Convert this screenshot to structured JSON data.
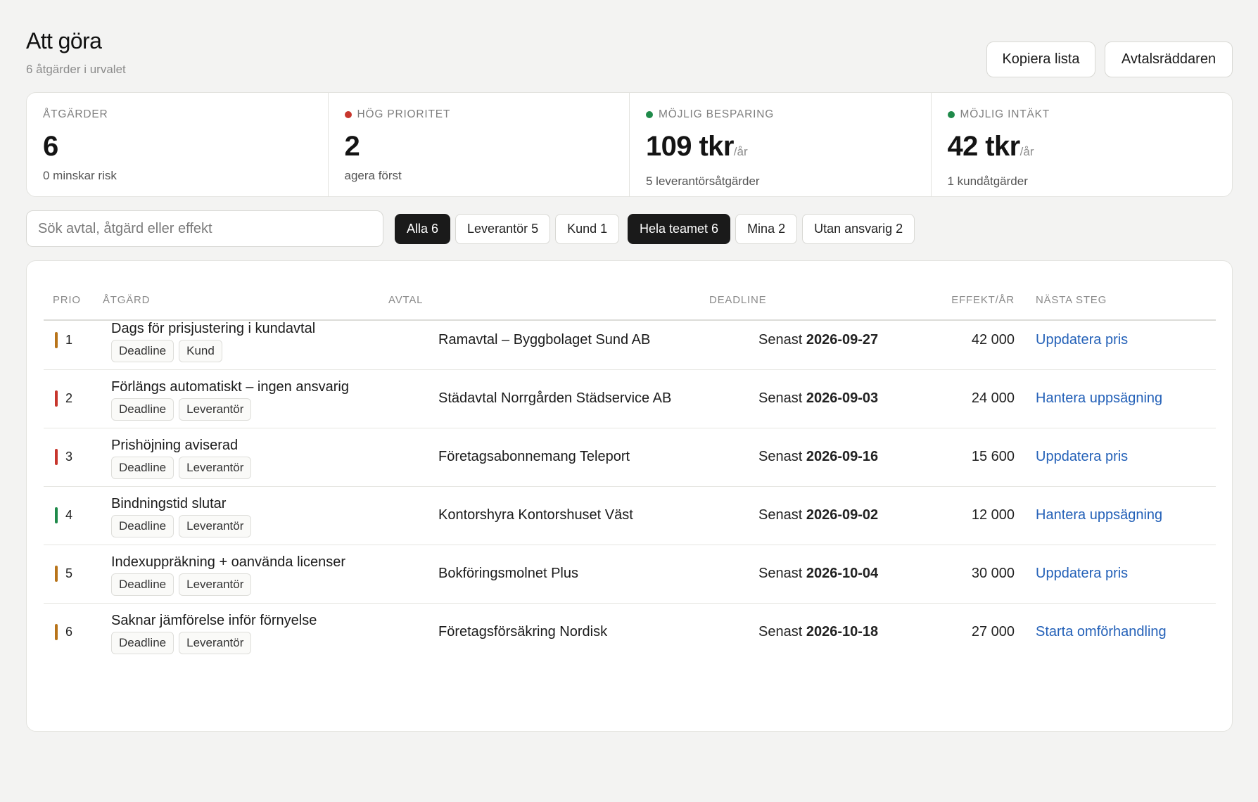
{
  "header": {
    "title": "Att göra",
    "subtitle": "6 åtgärder i urvalet",
    "copy_button": "Kopiera lista",
    "saver_button": "Avtalsräddaren"
  },
  "stats": [
    {
      "label": "ÅTGÄRDER",
      "value": "6",
      "unit": "",
      "sub": "0 minskar risk",
      "dot": ""
    },
    {
      "label": "HÖG PRIORITET",
      "value": "2",
      "unit": "",
      "sub": "agera först",
      "dot": "#c7362d"
    },
    {
      "label": "MÖJLIG BESPARING",
      "value": "109 tkr",
      "unit": "/år",
      "sub": "5 leverantörsåtgärder",
      "dot": "#1f8a4a"
    },
    {
      "label": "MÖJLIG INTÄKT",
      "value": "42 tkr",
      "unit": "/år",
      "sub": "1 kundåtgärder",
      "dot": "#1f8a4a"
    }
  ],
  "search": {
    "placeholder": "Sök avtal, åtgärd eller effekt"
  },
  "filters_type": [
    {
      "label": "Alla 6",
      "active": true
    },
    {
      "label": "Leverantör 5",
      "active": false
    },
    {
      "label": "Kund 1",
      "active": false
    }
  ],
  "filters_owner": [
    {
      "label": "Hela teamet 6",
      "active": true
    },
    {
      "label": "Mina 2",
      "active": false
    },
    {
      "label": "Utan ansvarig 2",
      "active": false
    }
  ],
  "table": {
    "headers": {
      "prio": "PRIO",
      "action": "ÅTGÄRD",
      "contract": "AVTAL",
      "deadline": "DEADLINE",
      "effect": "EFFEKT/ÅR",
      "next": "NÄSTA STEG"
    },
    "deadline_prefix": "Senast",
    "rows": [
      {
        "prio": "1",
        "prio_color": "#b8741a",
        "action": "Dags för prisjustering i kundavtal",
        "tags": [
          "Deadline",
          "Kund"
        ],
        "contract": "Ramavtal – Byggbolaget Sund AB",
        "deadline": "2026-09-27",
        "effect": "42 000",
        "next": "Uppdatera pris"
      },
      {
        "prio": "2",
        "prio_color": "#c7362d",
        "action": "Förlängs automatiskt – ingen ansvarig",
        "tags": [
          "Deadline",
          "Leverantör"
        ],
        "contract": "Städavtal Norrgården Städservice AB",
        "deadline": "2026-09-03",
        "effect": "24 000",
        "next": "Hantera uppsägning"
      },
      {
        "prio": "3",
        "prio_color": "#c7362d",
        "action": "Prishöjning aviserad",
        "tags": [
          "Deadline",
          "Leverantör"
        ],
        "contract": "Företagsabonnemang Teleport",
        "deadline": "2026-09-16",
        "effect": "15 600",
        "next": "Uppdatera pris"
      },
      {
        "prio": "4",
        "prio_color": "#1f8a4a",
        "action": "Bindningstid slutar",
        "tags": [
          "Deadline",
          "Leverantör"
        ],
        "contract": "Kontorshyra Kontorshuset Väst",
        "deadline": "2026-09-02",
        "effect": "12 000",
        "next": "Hantera uppsägning"
      },
      {
        "prio": "5",
        "prio_color": "#b8741a",
        "action": "Indexuppräkning + oanvända licenser",
        "tags": [
          "Deadline",
          "Leverantör"
        ],
        "contract": "Bokföringsmolnet Plus",
        "deadline": "2026-10-04",
        "effect": "30 000",
        "next": "Uppdatera pris"
      },
      {
        "prio": "6",
        "prio_color": "#b8741a",
        "action": "Saknar jämförelse inför förnyelse",
        "tags": [
          "Deadline",
          "Leverantör"
        ],
        "contract": "Företagsförsäkring Nordisk",
        "deadline": "2026-10-18",
        "effect": "27 000",
        "next": "Starta omförhandling"
      }
    ]
  }
}
